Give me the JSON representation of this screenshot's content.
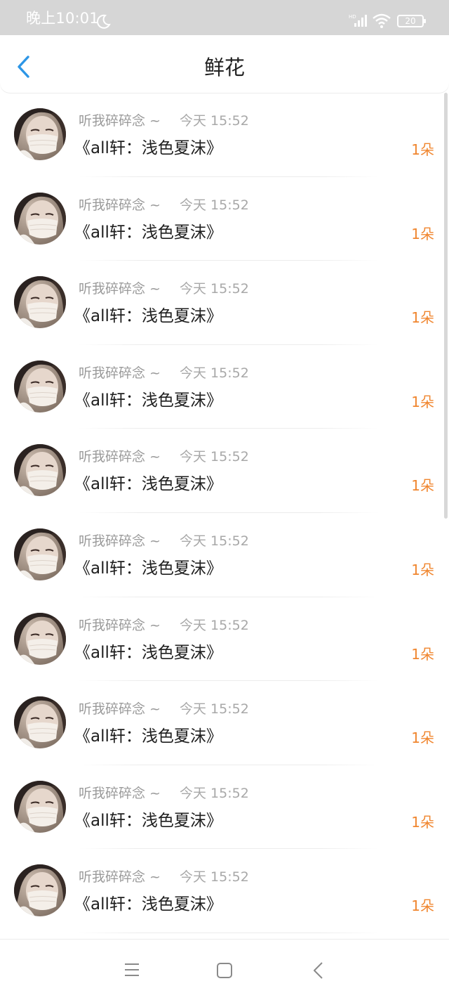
{
  "status_bar": {
    "time": "晚上10:01",
    "battery": "20"
  },
  "header": {
    "title": "鲜花"
  },
  "items": [
    {
      "name": "听我碎碎念 ~",
      "time": "今天 15:52",
      "title": "《all轩：浅色夏沫》",
      "count": "1朵"
    },
    {
      "name": "听我碎碎念 ~",
      "time": "今天 15:52",
      "title": "《all轩：浅色夏沫》",
      "count": "1朵"
    },
    {
      "name": "听我碎碎念 ~",
      "time": "今天 15:52",
      "title": "《all轩：浅色夏沫》",
      "count": "1朵"
    },
    {
      "name": "听我碎碎念 ~",
      "time": "今天 15:52",
      "title": "《all轩：浅色夏沫》",
      "count": "1朵"
    },
    {
      "name": "听我碎碎念 ~",
      "time": "今天 15:52",
      "title": "《all轩：浅色夏沫》",
      "count": "1朵"
    },
    {
      "name": "听我碎碎念 ~",
      "time": "今天 15:52",
      "title": "《all轩：浅色夏沫》",
      "count": "1朵"
    },
    {
      "name": "听我碎碎念 ~",
      "time": "今天 15:52",
      "title": "《all轩：浅色夏沫》",
      "count": "1朵"
    },
    {
      "name": "听我碎碎念 ~",
      "time": "今天 15:52",
      "title": "《all轩：浅色夏沫》",
      "count": "1朵"
    },
    {
      "name": "听我碎碎念 ~",
      "time": "今天 15:52",
      "title": "《all轩：浅色夏沫》",
      "count": "1朵"
    },
    {
      "name": "听我碎碎念 ~",
      "time": "今天 15:52",
      "title": "《all轩：浅色夏沫》",
      "count": "1朵"
    }
  ],
  "colors": {
    "accent": "#2d96e6",
    "count": "#f0862f",
    "status_bar": "#d6d6d6"
  },
  "icons": {
    "back": "chevron-left-icon",
    "moon": "moon-icon",
    "signal": "signal-icon",
    "wifi": "wifi-icon",
    "battery": "battery-icon",
    "menu": "menu-icon",
    "home": "home-square-icon",
    "system_back": "back-triangle-icon"
  }
}
